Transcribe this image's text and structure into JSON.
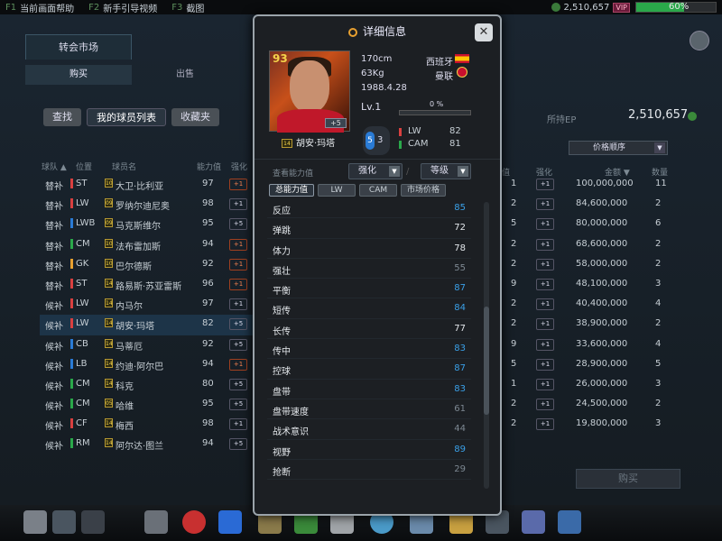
{
  "topbar": {
    "links": [
      {
        "key": "F1",
        "label": "当前画面帮助"
      },
      {
        "key": "F2",
        "label": "新手引导视频"
      },
      {
        "key": "F3",
        "label": "截图"
      }
    ],
    "ep": "2,510,657",
    "vip": "VIP",
    "battery_pct": 60,
    "battery_label": "60%"
  },
  "market": {
    "tab": "转会市场",
    "buy_tab": "购买",
    "sell_tab": "出售",
    "filters": [
      "查找",
      "我的球员列表",
      "收藏夹"
    ],
    "player_headers": {
      "team": "球队 ▲",
      "pos": "位置",
      "name": "球员名",
      "ovr": "能力值",
      "enh": "强化"
    },
    "players": [
      {
        "team": "替补",
        "pos": "ST",
        "color": "#d94040",
        "lvl": "10",
        "name": "大卫·比利亚",
        "ovr": "97",
        "enh": "+1",
        "neg": true
      },
      {
        "team": "替补",
        "pos": "LW",
        "color": "#d94040",
        "lvl": "09",
        "name": "罗纳尔迪尼奥",
        "ovr": "98",
        "enh": "+1",
        "neg": false
      },
      {
        "team": "替补",
        "pos": "LWB",
        "color": "#2a7bd5",
        "lvl": "09",
        "name": "马克斯维尔",
        "ovr": "95",
        "enh": "+5",
        "neg": false
      },
      {
        "team": "替补",
        "pos": "CM",
        "color": "#2aa84a",
        "lvl": "10",
        "name": "法布雷加斯",
        "ovr": "94",
        "enh": "+1",
        "neg": true
      },
      {
        "team": "替补",
        "pos": "GK",
        "color": "#e8a030",
        "lvl": "10",
        "name": "巴尔德斯",
        "ovr": "92",
        "enh": "+1",
        "neg": true
      },
      {
        "team": "替补",
        "pos": "ST",
        "color": "#d94040",
        "lvl": "14",
        "name": "路易斯·苏亚雷斯",
        "ovr": "96",
        "enh": "+1",
        "neg": true
      },
      {
        "team": "候补",
        "pos": "LW",
        "color": "#d94040",
        "lvl": "14",
        "name": "内马尔",
        "ovr": "97",
        "enh": "+1",
        "neg": false
      },
      {
        "team": "候补",
        "pos": "LW",
        "color": "#d94040",
        "lvl": "14",
        "name": "胡安·玛塔",
        "ovr": "82",
        "enh": "+5",
        "neg": false,
        "selected": true
      },
      {
        "team": "候补",
        "pos": "CB",
        "color": "#2a7bd5",
        "lvl": "14",
        "name": "马蒂厄",
        "ovr": "92",
        "enh": "+5",
        "neg": false
      },
      {
        "team": "候补",
        "pos": "LB",
        "color": "#2a7bd5",
        "lvl": "14",
        "name": "约迪·阿尔巴",
        "ovr": "94",
        "enh": "+1",
        "neg": true
      },
      {
        "team": "候补",
        "pos": "CM",
        "color": "#2aa84a",
        "lvl": "14",
        "name": "科克",
        "ovr": "80",
        "enh": "+5",
        "neg": false
      },
      {
        "team": "候补",
        "pos": "CM",
        "color": "#2aa84a",
        "lvl": "05",
        "name": "哈维",
        "ovr": "95",
        "enh": "+5",
        "neg": false
      },
      {
        "team": "候补",
        "pos": "CF",
        "color": "#d94040",
        "lvl": "14",
        "name": "梅西",
        "ovr": "98",
        "enh": "+1",
        "neg": false
      },
      {
        "team": "候补",
        "pos": "RM",
        "color": "#2aa84a",
        "lvl": "14",
        "name": "阿尔达·图兰",
        "ovr": "94",
        "enh": "+5",
        "neg": false
      }
    ],
    "ep_label": "所持EP",
    "ep_value": "2,510,657",
    "sort_label": "价格顺序",
    "market_headers": {
      "ovr": "值",
      "enh": "强化",
      "price": "金额 ▼",
      "qty": "数量"
    },
    "listings": [
      {
        "ovr": "1",
        "enh": "+1",
        "price": "100,000,000",
        "qty": "11"
      },
      {
        "ovr": "2",
        "enh": "+1",
        "price": "84,600,000",
        "qty": "2"
      },
      {
        "ovr": "5",
        "enh": "+1",
        "price": "80,000,000",
        "qty": "6"
      },
      {
        "ovr": "2",
        "enh": "+1",
        "price": "68,600,000",
        "qty": "2"
      },
      {
        "ovr": "2",
        "enh": "+1",
        "price": "58,000,000",
        "qty": "2"
      },
      {
        "ovr": "9",
        "enh": "+1",
        "price": "48,100,000",
        "qty": "3"
      },
      {
        "ovr": "2",
        "enh": "+1",
        "price": "40,400,000",
        "qty": "4"
      },
      {
        "ovr": "2",
        "enh": "+1",
        "price": "38,900,000",
        "qty": "2"
      },
      {
        "ovr": "9",
        "enh": "+1",
        "price": "33,600,000",
        "qty": "4"
      },
      {
        "ovr": "5",
        "enh": "+1",
        "price": "28,900,000",
        "qty": "5"
      },
      {
        "ovr": "1",
        "enh": "+1",
        "price": "26,000,000",
        "qty": "3"
      },
      {
        "ovr": "2",
        "enh": "+1",
        "price": "24,500,000",
        "qty": "2"
      },
      {
        "ovr": "2",
        "enh": "+1",
        "price": "19,800,000",
        "qty": "3"
      }
    ],
    "buy_button": "购买"
  },
  "modal": {
    "title": "详细信息",
    "player": {
      "ovr": "93",
      "enh": "+5",
      "lvl": "14",
      "name": "胡安·玛塔",
      "height": "170cm",
      "weight": "63Kg",
      "birth": "1988.4.28",
      "nation": "西班牙",
      "club": "曼联",
      "level_label": "Lv.1",
      "level_pct_label": "0 %",
      "level_pct": 0,
      "pos_num": "5",
      "pos_num2": "3",
      "positions": [
        {
          "pos": "LW",
          "value": "82",
          "color": "#d94040"
        },
        {
          "pos": "CAM",
          "value": "81",
          "color": "#2aa84a"
        }
      ]
    },
    "controls": {
      "label": "查看能力值",
      "enhance": "强化",
      "grade": "等级",
      "sep": "/"
    },
    "tabs": [
      "总能力值",
      "LW",
      "CAM",
      "市场价格"
    ],
    "stats": [
      {
        "name": "反应",
        "value": "85",
        "color": "#3aa0e8"
      },
      {
        "name": "弹跳",
        "value": "72",
        "color": "#e4e8ec"
      },
      {
        "name": "体力",
        "value": "78",
        "color": "#e4e8ec"
      },
      {
        "name": "强壮",
        "value": "55",
        "color": "#7d8892"
      },
      {
        "name": "平衡",
        "value": "87",
        "color": "#3aa0e8"
      },
      {
        "name": "短传",
        "value": "84",
        "color": "#3aa0e8"
      },
      {
        "name": "长传",
        "value": "77",
        "color": "#e4e8ec"
      },
      {
        "name": "传中",
        "value": "83",
        "color": "#3aa0e8"
      },
      {
        "name": "控球",
        "value": "87",
        "color": "#3aa0e8"
      },
      {
        "name": "盘带",
        "value": "83",
        "color": "#3aa0e8"
      },
      {
        "name": "盘带速度",
        "value": "61",
        "color": "#7d8892"
      },
      {
        "name": "战术意识",
        "value": "44",
        "color": "#7d8892"
      },
      {
        "name": "视野",
        "value": "89",
        "color": "#3aa0e8"
      },
      {
        "name": "抢断",
        "value": "29",
        "color": "#7d8892"
      }
    ]
  }
}
